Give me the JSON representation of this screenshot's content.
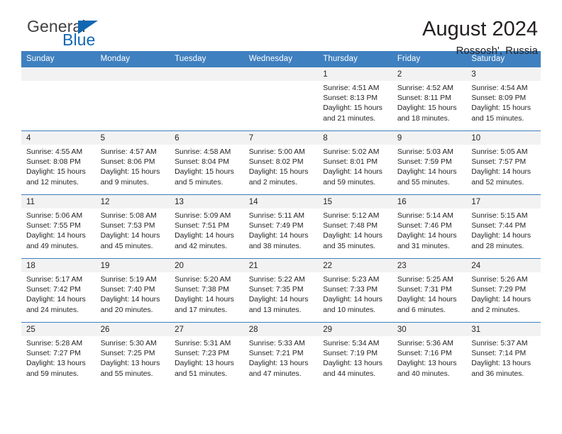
{
  "logo": {
    "word1": "General",
    "word2": "Blue",
    "triangle_color": "#1267b2"
  },
  "header": {
    "title": "August 2024",
    "subtitle": "Rossosh', Russia"
  },
  "theme": {
    "header_blue": "#3f80c0",
    "daynum_bg": "#f2f2f2",
    "text": "#231f20"
  },
  "labels": {
    "sunrise": "Sunrise:",
    "sunset": "Sunset:",
    "daylight": "Daylight:"
  },
  "weekdays": [
    "Sunday",
    "Monday",
    "Tuesday",
    "Wednesday",
    "Thursday",
    "Friday",
    "Saturday"
  ],
  "weeks": [
    [
      {
        "day": "",
        "lines": []
      },
      {
        "day": "",
        "lines": []
      },
      {
        "day": "",
        "lines": []
      },
      {
        "day": "",
        "lines": []
      },
      {
        "day": "1",
        "lines": [
          "Sunrise: 4:51 AM",
          "Sunset: 8:13 PM",
          "Daylight: 15 hours",
          "and 21 minutes."
        ]
      },
      {
        "day": "2",
        "lines": [
          "Sunrise: 4:52 AM",
          "Sunset: 8:11 PM",
          "Daylight: 15 hours",
          "and 18 minutes."
        ]
      },
      {
        "day": "3",
        "lines": [
          "Sunrise: 4:54 AM",
          "Sunset: 8:09 PM",
          "Daylight: 15 hours",
          "and 15 minutes."
        ]
      }
    ],
    [
      {
        "day": "4",
        "lines": [
          "Sunrise: 4:55 AM",
          "Sunset: 8:08 PM",
          "Daylight: 15 hours",
          "and 12 minutes."
        ]
      },
      {
        "day": "5",
        "lines": [
          "Sunrise: 4:57 AM",
          "Sunset: 8:06 PM",
          "Daylight: 15 hours",
          "and 9 minutes."
        ]
      },
      {
        "day": "6",
        "lines": [
          "Sunrise: 4:58 AM",
          "Sunset: 8:04 PM",
          "Daylight: 15 hours",
          "and 5 minutes."
        ]
      },
      {
        "day": "7",
        "lines": [
          "Sunrise: 5:00 AM",
          "Sunset: 8:02 PM",
          "Daylight: 15 hours",
          "and 2 minutes."
        ]
      },
      {
        "day": "8",
        "lines": [
          "Sunrise: 5:02 AM",
          "Sunset: 8:01 PM",
          "Daylight: 14 hours",
          "and 59 minutes."
        ]
      },
      {
        "day": "9",
        "lines": [
          "Sunrise: 5:03 AM",
          "Sunset: 7:59 PM",
          "Daylight: 14 hours",
          "and 55 minutes."
        ]
      },
      {
        "day": "10",
        "lines": [
          "Sunrise: 5:05 AM",
          "Sunset: 7:57 PM",
          "Daylight: 14 hours",
          "and 52 minutes."
        ]
      }
    ],
    [
      {
        "day": "11",
        "lines": [
          "Sunrise: 5:06 AM",
          "Sunset: 7:55 PM",
          "Daylight: 14 hours",
          "and 49 minutes."
        ]
      },
      {
        "day": "12",
        "lines": [
          "Sunrise: 5:08 AM",
          "Sunset: 7:53 PM",
          "Daylight: 14 hours",
          "and 45 minutes."
        ]
      },
      {
        "day": "13",
        "lines": [
          "Sunrise: 5:09 AM",
          "Sunset: 7:51 PM",
          "Daylight: 14 hours",
          "and 42 minutes."
        ]
      },
      {
        "day": "14",
        "lines": [
          "Sunrise: 5:11 AM",
          "Sunset: 7:49 PM",
          "Daylight: 14 hours",
          "and 38 minutes."
        ]
      },
      {
        "day": "15",
        "lines": [
          "Sunrise: 5:12 AM",
          "Sunset: 7:48 PM",
          "Daylight: 14 hours",
          "and 35 minutes."
        ]
      },
      {
        "day": "16",
        "lines": [
          "Sunrise: 5:14 AM",
          "Sunset: 7:46 PM",
          "Daylight: 14 hours",
          "and 31 minutes."
        ]
      },
      {
        "day": "17",
        "lines": [
          "Sunrise: 5:15 AM",
          "Sunset: 7:44 PM",
          "Daylight: 14 hours",
          "and 28 minutes."
        ]
      }
    ],
    [
      {
        "day": "18",
        "lines": [
          "Sunrise: 5:17 AM",
          "Sunset: 7:42 PM",
          "Daylight: 14 hours",
          "and 24 minutes."
        ]
      },
      {
        "day": "19",
        "lines": [
          "Sunrise: 5:19 AM",
          "Sunset: 7:40 PM",
          "Daylight: 14 hours",
          "and 20 minutes."
        ]
      },
      {
        "day": "20",
        "lines": [
          "Sunrise: 5:20 AM",
          "Sunset: 7:38 PM",
          "Daylight: 14 hours",
          "and 17 minutes."
        ]
      },
      {
        "day": "21",
        "lines": [
          "Sunrise: 5:22 AM",
          "Sunset: 7:35 PM",
          "Daylight: 14 hours",
          "and 13 minutes."
        ]
      },
      {
        "day": "22",
        "lines": [
          "Sunrise: 5:23 AM",
          "Sunset: 7:33 PM",
          "Daylight: 14 hours",
          "and 10 minutes."
        ]
      },
      {
        "day": "23",
        "lines": [
          "Sunrise: 5:25 AM",
          "Sunset: 7:31 PM",
          "Daylight: 14 hours",
          "and 6 minutes."
        ]
      },
      {
        "day": "24",
        "lines": [
          "Sunrise: 5:26 AM",
          "Sunset: 7:29 PM",
          "Daylight: 14 hours",
          "and 2 minutes."
        ]
      }
    ],
    [
      {
        "day": "25",
        "lines": [
          "Sunrise: 5:28 AM",
          "Sunset: 7:27 PM",
          "Daylight: 13 hours",
          "and 59 minutes."
        ]
      },
      {
        "day": "26",
        "lines": [
          "Sunrise: 5:30 AM",
          "Sunset: 7:25 PM",
          "Daylight: 13 hours",
          "and 55 minutes."
        ]
      },
      {
        "day": "27",
        "lines": [
          "Sunrise: 5:31 AM",
          "Sunset: 7:23 PM",
          "Daylight: 13 hours",
          "and 51 minutes."
        ]
      },
      {
        "day": "28",
        "lines": [
          "Sunrise: 5:33 AM",
          "Sunset: 7:21 PM",
          "Daylight: 13 hours",
          "and 47 minutes."
        ]
      },
      {
        "day": "29",
        "lines": [
          "Sunrise: 5:34 AM",
          "Sunset: 7:19 PM",
          "Daylight: 13 hours",
          "and 44 minutes."
        ]
      },
      {
        "day": "30",
        "lines": [
          "Sunrise: 5:36 AM",
          "Sunset: 7:16 PM",
          "Daylight: 13 hours",
          "and 40 minutes."
        ]
      },
      {
        "day": "31",
        "lines": [
          "Sunrise: 5:37 AM",
          "Sunset: 7:14 PM",
          "Daylight: 13 hours",
          "and 36 minutes."
        ]
      }
    ]
  ]
}
